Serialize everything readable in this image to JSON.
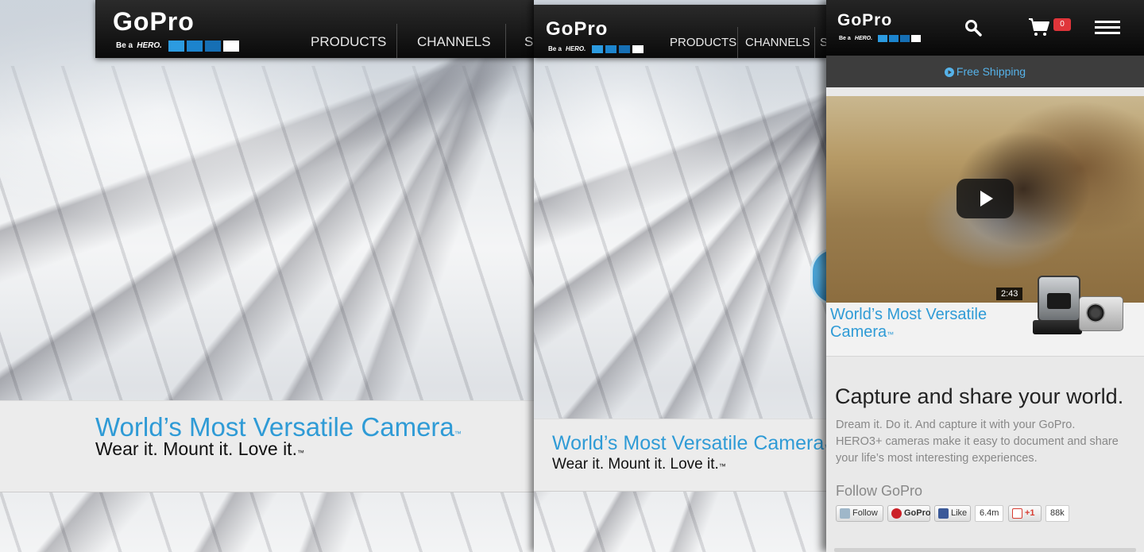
{
  "brand": {
    "logo_word": "GoPro",
    "tagline_prefix": "Be a",
    "tagline_hero": "HERO.",
    "colors": {
      "accent_blue": "#2f9bd6",
      "header_black": "#0a0a0a",
      "ship_blue": "#56b3ea",
      "cart_badge_red": "#e0353a"
    }
  },
  "desktop": {
    "nav": [
      "PRODUCTS",
      "CHANNELS",
      "S"
    ],
    "hero": {
      "title": "World’s Most Versatile Camera",
      "title_tm": "™",
      "subtitle": "Wear it. Mount it. Love it.",
      "subtitle_tm": "™"
    }
  },
  "tablet": {
    "nav": [
      "PRODUCTS",
      "CHANNELS",
      "S"
    ],
    "hero": {
      "title": "World’s Most Versatile Camera",
      "title_tm": "™",
      "subtitle": "Wear it. Mount it. Love it.",
      "subtitle_tm": "™"
    }
  },
  "mobile": {
    "header": {
      "search_icon": "search-icon",
      "cart_icon": "cart-icon",
      "cart_count": "0",
      "menu_icon": "hamburger-menu-icon"
    },
    "shipping": {
      "icon": "play-circle-icon",
      "label": "Free Shipping"
    },
    "video": {
      "duration": "2:43"
    },
    "camera_title": "World’s Most Versatile Camera",
    "camera_title_tm": "™",
    "headline": "Capture and share your world.",
    "description": "Dream it. Do it. And capture it with your GoPro. HERO3+ cameras make it easy to document and share your life’s most interesting experiences.",
    "follow_label": "Follow GoPro",
    "social": {
      "twitter": "Follow",
      "pinterest": "GoPro",
      "facebook": "Like",
      "facebook_count": "6.4m",
      "gplus": "+1",
      "gplus_count": "88k"
    }
  }
}
